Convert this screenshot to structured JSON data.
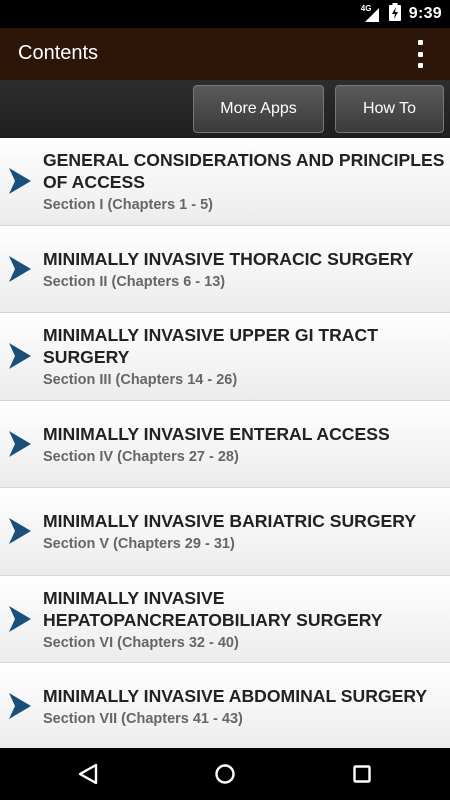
{
  "status_bar": {
    "network": "4G",
    "time": "9:39"
  },
  "app_bar": {
    "title": "Contents"
  },
  "toolbar": {
    "more_apps_label": "More Apps",
    "how_to_label": "How To"
  },
  "sections": [
    {
      "title": "GENERAL CONSIDERATIONS AND PRINCIPLES OF ACCESS",
      "subtitle": "Section I (Chapters 1 - 5)"
    },
    {
      "title": "MINIMALLY INVASIVE THORACIC SURGERY",
      "subtitle": "Section II (Chapters 6 - 13)"
    },
    {
      "title": "MINIMALLY INVASIVE UPPER GI TRACT SURGERY",
      "subtitle": "Section III (Chapters 14 - 26)"
    },
    {
      "title": "MINIMALLY INVASIVE ENTERAL ACCESS",
      "subtitle": "Section IV (Chapters 27 - 28)"
    },
    {
      "title": "MINIMALLY INVASIVE BARIATRIC SURGERY",
      "subtitle": "Section V (Chapters 29 - 31)"
    },
    {
      "title": "MINIMALLY INVASIVE HEPATOPANCREATOBILIARY SURGERY",
      "subtitle": "Section VI (Chapters 32 - 40)"
    },
    {
      "title": "MINIMALLY INVASIVE ABDOMINAL SURGERY",
      "subtitle": "Section VII (Chapters 41 - 43)"
    }
  ],
  "colors": {
    "app_bar": "#2d1507",
    "chevron": "#1a4f7a",
    "row_title": "#222222",
    "row_subtitle": "#666666"
  },
  "icons": {
    "row_indicator": "chevron-right-icon",
    "overflow": "overflow-menu-icon",
    "nav": [
      "back-icon",
      "home-icon",
      "recents-icon"
    ]
  }
}
